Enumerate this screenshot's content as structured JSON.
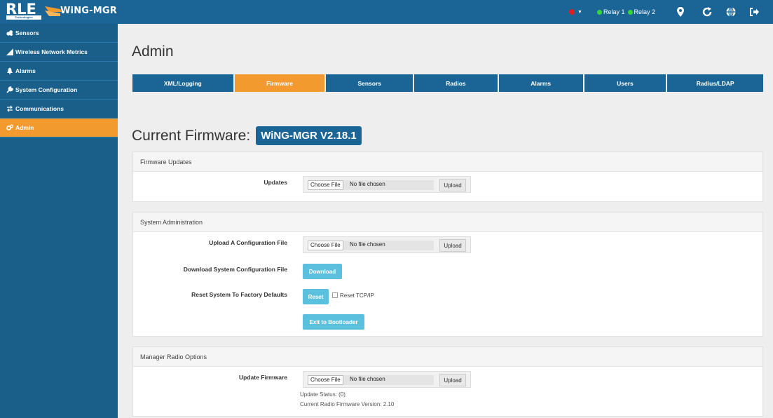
{
  "brand": {
    "company": "RLE",
    "company_tagline": "Technologies",
    "product": "WiNG-MGR"
  },
  "topbar": {
    "relays": [
      {
        "label": "Relay 1",
        "color": "#35d635"
      },
      {
        "label": "Relay 2",
        "color": "#35d635"
      }
    ],
    "alarm_color": "#e02020",
    "icons": [
      "map-marker-icon",
      "refresh-icon",
      "globe-icon",
      "logout-icon"
    ]
  },
  "sidebar": {
    "items": [
      {
        "label": "Sensors",
        "icon": "sensors-icon"
      },
      {
        "label": "Wireless Network Metrics",
        "icon": "signal-icon"
      },
      {
        "label": "Alarms",
        "icon": "bell-icon"
      },
      {
        "label": "System Configuration",
        "icon": "wrench-icon"
      },
      {
        "label": "Communications",
        "icon": "exchange-icon"
      },
      {
        "label": "Admin",
        "icon": "cogs-icon",
        "active": true
      }
    ]
  },
  "page": {
    "title": "Admin"
  },
  "tabs": [
    {
      "label": "XML/Logging"
    },
    {
      "label": "Firmware",
      "active": true
    },
    {
      "label": "Sensors"
    },
    {
      "label": "Radios"
    },
    {
      "label": "Alarms"
    },
    {
      "label": "Users"
    },
    {
      "label": "Radius/LDAP"
    }
  ],
  "firmware": {
    "label": "Current Firmware:",
    "version": "WiNG-MGR V2.18.1"
  },
  "file_input": {
    "choose_label": "Choose File",
    "no_file": "No file chosen",
    "upload_label": "Upload"
  },
  "firmware_updates": {
    "heading": "Firmware Updates",
    "updates_label": "Updates"
  },
  "system_admin": {
    "heading": "System Administration",
    "upload_config_label": "Upload A Configuration File",
    "download_config_label": "Download System Configuration File",
    "download_button": "Download",
    "reset_label": "Reset System To Factory Defaults",
    "reset_button": "Reset",
    "reset_tcpip_label": "Reset TCP/IP",
    "bootloader_button": "Exit to Bootloader"
  },
  "radio_options": {
    "heading": "Manager Radio Options",
    "update_firmware_label": "Update Firmware",
    "update_status": "Update Status: (0)",
    "radio_version": "Current Radio Firmware Version: 2.10"
  },
  "colors": {
    "primary": "#1a6596",
    "accent": "#f39a2f",
    "info": "#5bc0de"
  }
}
